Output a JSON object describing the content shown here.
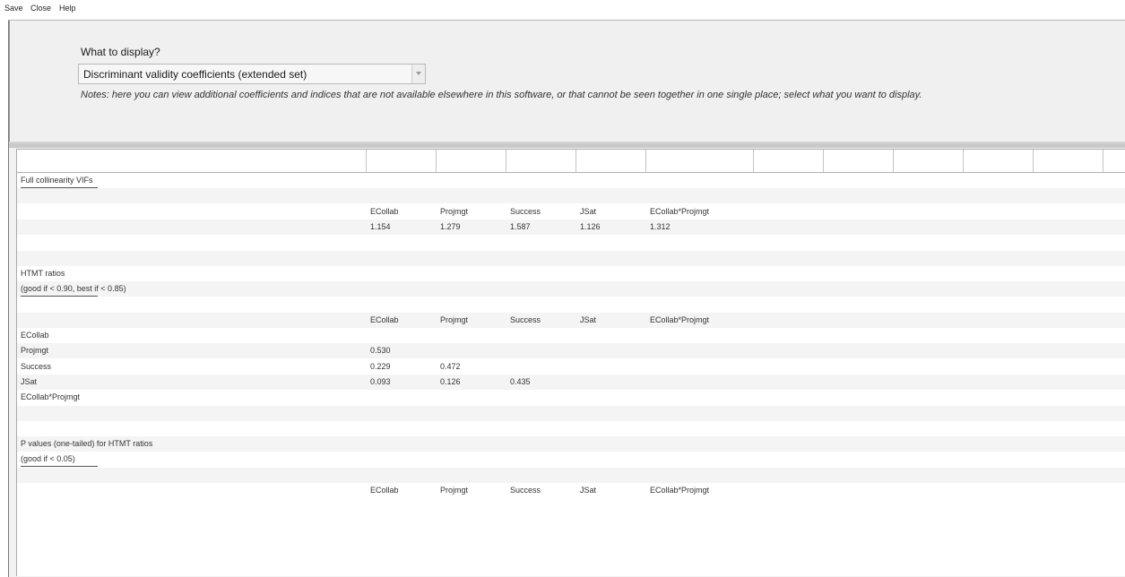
{
  "menu": {
    "items": [
      "Save",
      "Close",
      "Help"
    ]
  },
  "panel": {
    "prompt": "What to display?",
    "select_value": "Discriminant validity coefficients (extended set)",
    "notes": "Notes: here you can view additional coefficients and indices that are not available elsewhere in this software, or that cannot be seen together in one single place; select what you want to display."
  },
  "grid": {
    "rows": [
      {
        "cells": [
          "Full collinearity VIFs",
          "",
          "",
          "",
          "",
          ""
        ],
        "underline": true
      },
      {
        "cells": [
          "",
          "",
          "",
          "",
          "",
          ""
        ]
      },
      {
        "cells": [
          "",
          "ECollab",
          "Projmgt",
          "Success",
          "JSat",
          "ECollab*Projmgt"
        ]
      },
      {
        "cells": [
          "",
          "1.154",
          "1.279",
          "1.587",
          "1.126",
          "1.312"
        ]
      },
      {
        "cells": [
          "",
          "",
          "",
          "",
          "",
          ""
        ]
      },
      {
        "cells": [
          "",
          "",
          "",
          "",
          "",
          ""
        ]
      },
      {
        "cells": [
          "HTMT ratios",
          "",
          "",
          "",
          "",
          ""
        ]
      },
      {
        "cells": [
          "(good if < 0.90, best if < 0.85)",
          "",
          "",
          "",
          "",
          ""
        ],
        "underline": true
      },
      {
        "cells": [
          "",
          "",
          "",
          "",
          "",
          ""
        ]
      },
      {
        "cells": [
          "",
          "ECollab",
          "Projmgt",
          "Success",
          "JSat",
          "ECollab*Projmgt"
        ]
      },
      {
        "cells": [
          "ECollab",
          "",
          "",
          "",
          "",
          ""
        ]
      },
      {
        "cells": [
          "Projmgt",
          "0.530",
          "",
          "",
          "",
          ""
        ]
      },
      {
        "cells": [
          "Success",
          "0.229",
          "0.472",
          "",
          "",
          ""
        ]
      },
      {
        "cells": [
          "JSat",
          "0.093",
          "0.126",
          "0.435",
          "",
          ""
        ]
      },
      {
        "cells": [
          "ECollab*Projmgt",
          "",
          "",
          "",
          "",
          ""
        ]
      },
      {
        "cells": [
          "",
          "",
          "",
          "",
          "",
          ""
        ]
      },
      {
        "cells": [
          "",
          "",
          "",
          "",
          "",
          ""
        ]
      },
      {
        "cells": [
          "P values (one-tailed) for HTMT ratios",
          "",
          "",
          "",
          "",
          ""
        ]
      },
      {
        "cells": [
          "(good if < 0.05)",
          "",
          "",
          "",
          "",
          ""
        ],
        "underline": true
      },
      {
        "cells": [
          "",
          "",
          "",
          "",
          "",
          ""
        ]
      },
      {
        "cells": [
          "",
          "ECollab",
          "Projmgt",
          "Success",
          "JSat",
          "ECollab*Projmgt"
        ]
      }
    ]
  }
}
